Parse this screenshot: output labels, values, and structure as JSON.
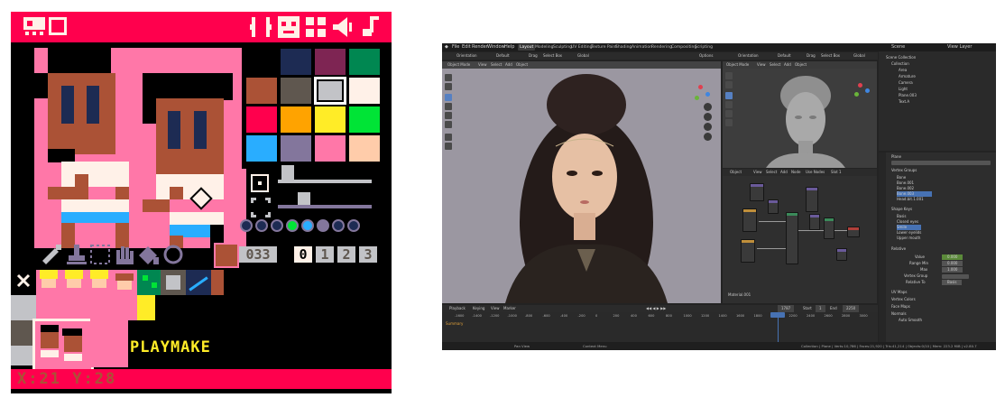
{
  "pico8": {
    "colors": {
      "black": "#000000",
      "dark_blue": "#1d2b53",
      "dark_purple": "#7e2553",
      "dark_green": "#008751",
      "brown": "#ab5236",
      "dark_grey": "#5f574f",
      "light_grey": "#c2c3c7",
      "white": "#fff1e8",
      "red": "#ff004d",
      "orange": "#ffa300",
      "yellow": "#ffec27",
      "green": "#00e436",
      "blue": "#29adff",
      "lavender": "#83769c",
      "pink": "#ff77a8",
      "peach": "#ffccaa"
    },
    "top_icons_left": [
      "sprite-editor-icon",
      "map-editor-icon"
    ],
    "top_icons_right": [
      "code-editor-icon",
      "sprite-editor-icon",
      "map-editor-icon",
      "sfx-editor-icon",
      "music-editor-icon"
    ],
    "tools": [
      "pencil-icon",
      "stamp-icon",
      "select-icon",
      "pan-icon",
      "fill-icon",
      "shape-icon"
    ],
    "sprite_number": "033",
    "sheet_tabs": [
      "0",
      "1",
      "2",
      "3"
    ],
    "playmaker_label": "PLAYMAKE",
    "status": {
      "x_label": "X:",
      "x_value": "21",
      "y_label": "Y:",
      "y_value": "28"
    }
  },
  "blender": {
    "menu": [
      "File",
      "Edit",
      "Render",
      "Window",
      "Help"
    ],
    "workspaces": [
      "Layout",
      "Modeling",
      "Sculpting",
      "UV Editing",
      "Texture Paint",
      "Shading",
      "Animation",
      "Rendering",
      "Compositing",
      "Scripting"
    ],
    "active_workspace": "Layout",
    "scene_label": "Scene",
    "view_layer_label": "View Layer",
    "viewport_header": [
      "Object Mode",
      "View",
      "Select",
      "Add",
      "Object"
    ],
    "orientation": "Orientation",
    "default_label": "Default",
    "drag_label": "Drag",
    "select_box": "Select Box",
    "global_label": "Global",
    "options_label": "Options",
    "sculpt_header": [
      "Object Mode",
      "View",
      "Select",
      "Add",
      "Object"
    ],
    "node_header": [
      "Object",
      "View",
      "Select",
      "Add",
      "Node",
      "Use Nodes",
      "Slot 1"
    ],
    "outliner": [
      "Scene Collection",
      "Collection",
      "Area",
      "Armature",
      "Camera",
      "Light",
      "Plane.003",
      "Text.A"
    ],
    "properties": {
      "object_label": "Plane",
      "sections": [
        "Vertex Groups",
        "Shape Keys",
        "UV Maps",
        "Vertex Colors",
        "Face Maps",
        "Normals"
      ],
      "vertex_groups": [
        "Bone",
        "Bone.001",
        "Bone.002",
        "Bone.003",
        "Head.bit.1.001"
      ],
      "shape_keys": [
        "Basis",
        "Closed eyes",
        "Smile",
        "Lower eyelids",
        "Upper mouth"
      ],
      "relative": "Relative",
      "value_label": "Value",
      "value": "0.000",
      "range_min_label": "Range Min",
      "range_min": "0.000",
      "max_label": "Max",
      "max": "1.000",
      "vertex_group_label": "Vertex Group",
      "relative_to_label": "Relative To",
      "relative_to": "Basis",
      "auto_smooth": "Auto Smooth"
    },
    "timeline": {
      "menu": [
        "Playback",
        "Keying",
        "View",
        "Marker"
      ],
      "summary": "Summary",
      "frames": [
        "-1600",
        "-1400",
        "-1200",
        "-1000",
        "-800",
        "-600",
        "-400",
        "-200",
        "0",
        "200",
        "400",
        "600",
        "800",
        "1000",
        "1200",
        "1400",
        "1600",
        "1800",
        "2000",
        "2200",
        "2400",
        "2600",
        "2800",
        "3000"
      ],
      "current_frame": "1787",
      "start_label": "Start",
      "start": "1",
      "end_label": "End",
      "end": "2250"
    },
    "material_label": "Material.001",
    "status_left": [
      "Pan View",
      "Context Menu"
    ],
    "status_right": "Collection | Plane | Verts:10,786 | Faces:21,920 | Tris:41,214 | Objects:0/10 | Mem: 223.2 MiB | v2.80.7"
  }
}
